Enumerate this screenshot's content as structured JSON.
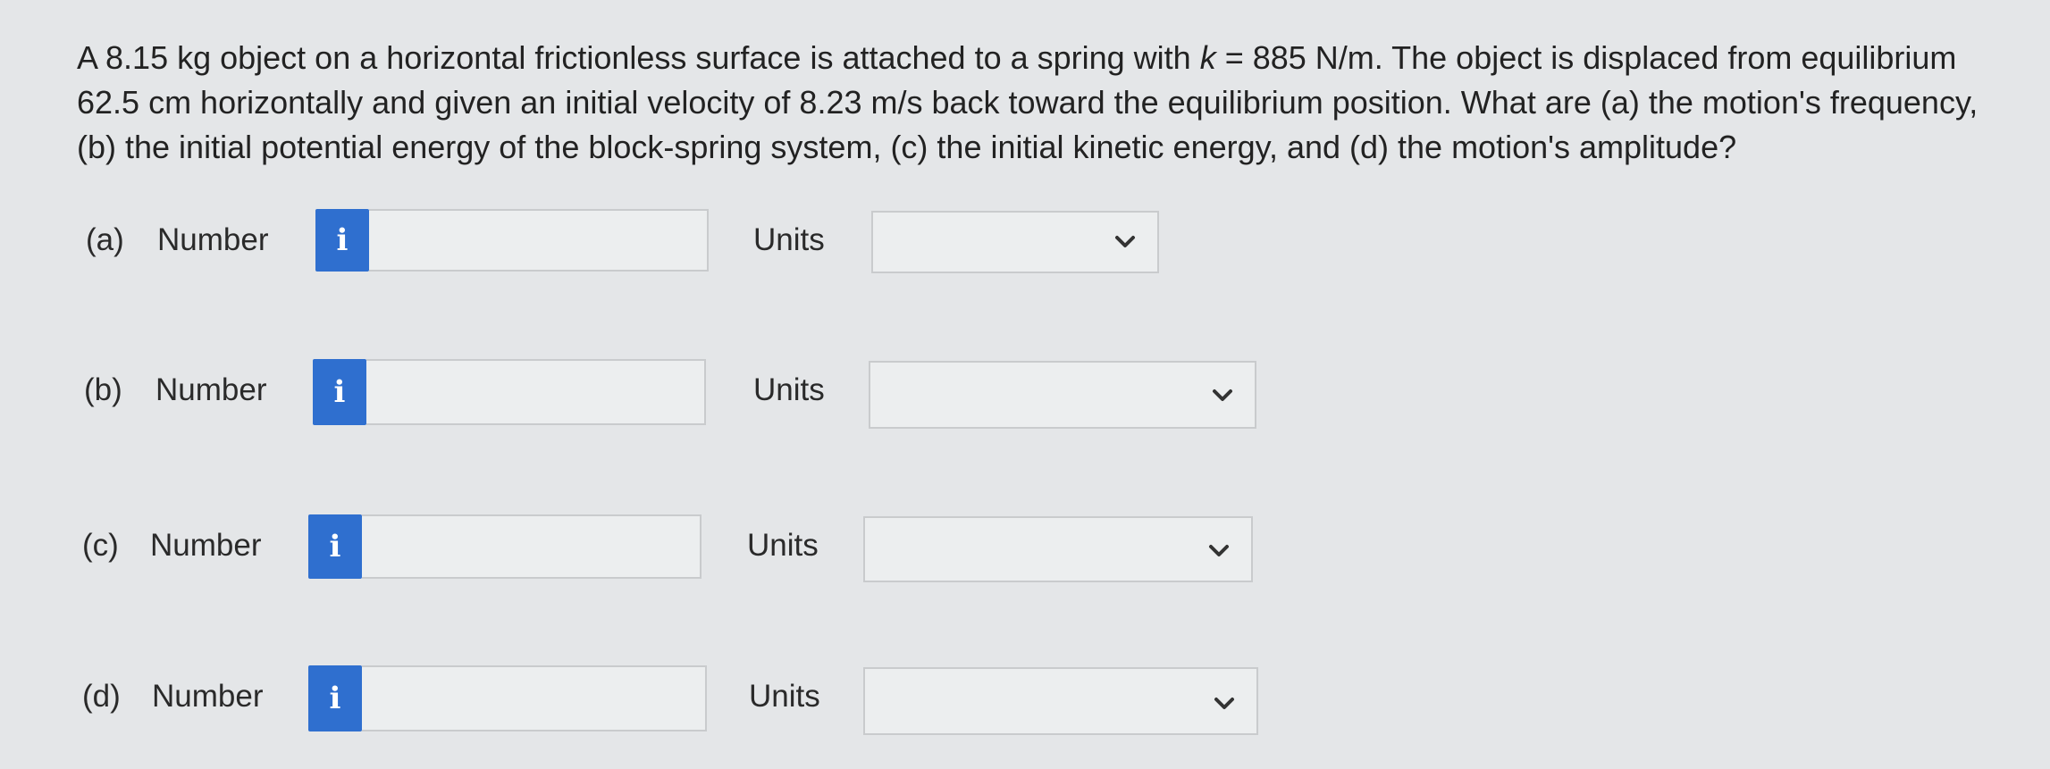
{
  "question": {
    "text_part1": "A 8.15 kg object on a horizontal frictionless surface is attached to a spring with ",
    "k_symbol": "k",
    "text_part2": " = 885 N/m. The object is displaced from equilibrium 62.5 cm horizontally and given an initial velocity of 8.23 m/s back toward the equilibrium position. What are (a) the motion's frequency, (b) the initial potential energy of the block-spring system, (c) the initial kinetic energy, and (d) the motion's amplitude?"
  },
  "answers": [
    {
      "part": "(a)",
      "number_label": "Number",
      "info_icon": "i",
      "number_value": "",
      "units_label": "Units",
      "units_value": ""
    },
    {
      "part": "(b)",
      "number_label": "Number",
      "info_icon": "i",
      "number_value": "",
      "units_label": "Units",
      "units_value": ""
    },
    {
      "part": "(c)",
      "number_label": "Number",
      "info_icon": "i",
      "number_value": "",
      "units_label": "Units",
      "units_value": ""
    },
    {
      "part": "(d)",
      "number_label": "Number",
      "info_icon": "i",
      "number_value": "",
      "units_label": "Units",
      "units_value": ""
    }
  ],
  "colors": {
    "info_button": "#2f6fcf",
    "background": "#e4e6e8"
  }
}
